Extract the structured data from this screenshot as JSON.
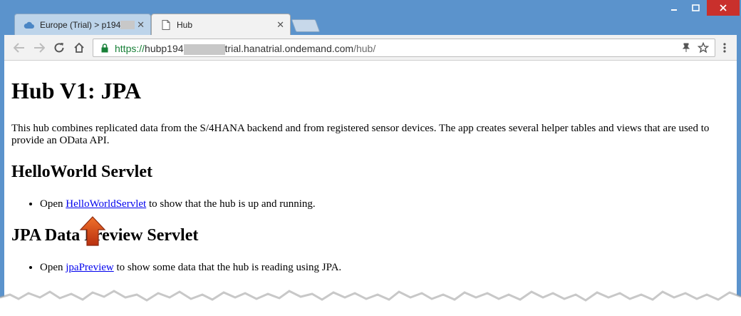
{
  "browser": {
    "tabs": [
      {
        "label": "Europe (Trial) > p194",
        "icon": "cloud-icon"
      },
      {
        "label": "Hub",
        "icon": "page-icon"
      }
    ],
    "address": {
      "scheme": "https://",
      "host_before": "hubp194",
      "host_after": "trial.hanatrial.ondemand.com",
      "path": "/hub/"
    },
    "colors": {
      "frame": "#5b93cc",
      "close_button": "#c9302c",
      "link": "#0000ee"
    }
  },
  "page": {
    "title": "Hub V1: JPA",
    "description": "This hub combines replicated data from the S/4HANA backend and from registered sensor devices. The app creates several helper tables and views that are used to provide an OData API.",
    "sections": [
      {
        "heading": "HelloWorld Servlet",
        "item": {
          "prefix": "Open ",
          "link": "HelloWorldServlet",
          "suffix": " to show that the hub is up and running."
        }
      },
      {
        "heading": "JPA Data Preview Servlet",
        "item": {
          "prefix": "Open ",
          "link": "jpaPreview",
          "suffix": " to show some data that the hub is reading using JPA."
        }
      }
    ]
  }
}
